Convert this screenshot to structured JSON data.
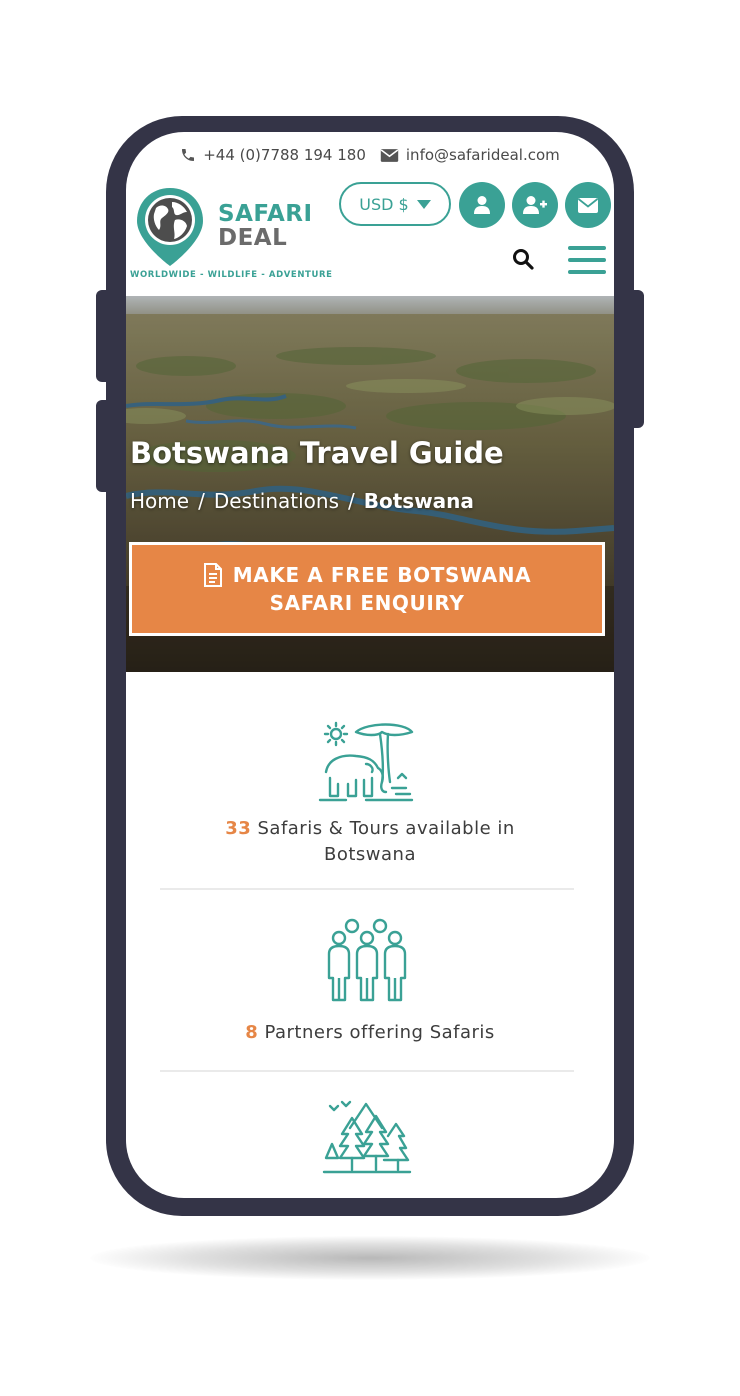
{
  "topbar": {
    "phone": "+44 (0)7788 194 180",
    "email": "info@safarideal.com"
  },
  "header": {
    "logo_line1": "SAFARI",
    "logo_line2": "DEAL",
    "tagline": "WORLDWIDE - WILDLIFE - ADVENTURE",
    "currency": "USD $"
  },
  "hero": {
    "title": "Botswana Travel Guide",
    "breadcrumb": [
      "Home",
      "Destinations",
      "Botswana"
    ],
    "enquiry_line1": "MAKE A FREE BOTSWANA",
    "enquiry_line2": "SAFARI ENQUIRY"
  },
  "stats": [
    {
      "icon": "elephant-icon",
      "number": "33",
      "text1": "Safaris & Tours available in",
      "text2": "Botswana"
    },
    {
      "icon": "people-icon",
      "number": "8",
      "text1": "Partners offering Safaris",
      "text2": ""
    },
    {
      "icon": "forest-icon",
      "number": "",
      "text1": "",
      "text2": ""
    }
  ],
  "colors": {
    "brand_teal": "#3aa195",
    "accent_orange": "#e68646",
    "device_frame": "#343447"
  }
}
